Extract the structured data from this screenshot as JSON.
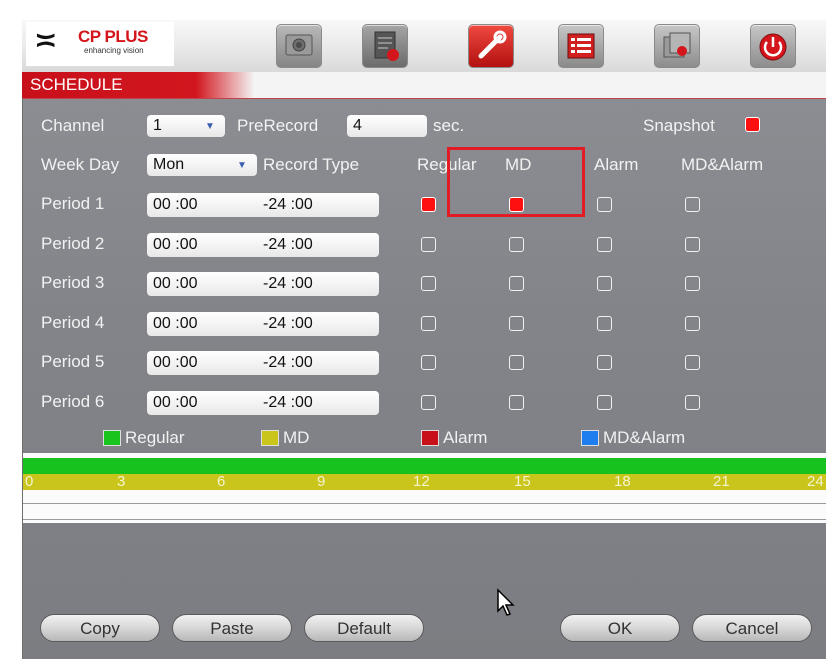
{
  "logo": {
    "brand": "CP PLUS",
    "tagline": "enhancing vision"
  },
  "toolbar": {
    "icons": [
      "camera-icon",
      "document-settings-icon",
      "wrench-icon",
      "list-icon",
      "backup-icon",
      "power-icon"
    ]
  },
  "window": {
    "title": "SCHEDULE"
  },
  "form": {
    "channel_label": "Channel",
    "channel_value": "1",
    "prerecord_label": "PreRecord",
    "prerecord_value": "4",
    "prerecord_unit": "sec.",
    "snapshot_label": "Snapshot",
    "snapshot_checked": true,
    "weekday_label": "Week Day",
    "weekday_value": "Mon",
    "record_type_label": "Record Type",
    "columns": [
      "Regular",
      "MD",
      "Alarm",
      "MD&Alarm"
    ]
  },
  "periods": [
    {
      "label": "Period 1",
      "start": "00 :00",
      "end": "-24 :00",
      "regular": true,
      "md": true,
      "alarm": false,
      "md_alarm": false
    },
    {
      "label": "Period 2",
      "start": "00 :00",
      "end": "-24 :00",
      "regular": false,
      "md": false,
      "alarm": false,
      "md_alarm": false
    },
    {
      "label": "Period 3",
      "start": "00 :00",
      "end": "-24 :00",
      "regular": false,
      "md": false,
      "alarm": false,
      "md_alarm": false
    },
    {
      "label": "Period 4",
      "start": "00 :00",
      "end": "-24 :00",
      "regular": false,
      "md": false,
      "alarm": false,
      "md_alarm": false
    },
    {
      "label": "Period 5",
      "start": "00 :00",
      "end": "-24 :00",
      "regular": false,
      "md": false,
      "alarm": false,
      "md_alarm": false
    },
    {
      "label": "Period 6",
      "start": "00 :00",
      "end": "-24 :00",
      "regular": false,
      "md": false,
      "alarm": false,
      "md_alarm": false
    }
  ],
  "legend": [
    {
      "label": "Regular",
      "color": "#19c41f"
    },
    {
      "label": "MD",
      "color": "#c9c51a"
    },
    {
      "label": "Alarm",
      "color": "#c8101a"
    },
    {
      "label": "MD&Alarm",
      "color": "#1e7ef0"
    }
  ],
  "timeline": {
    "ticks": [
      "0",
      "3",
      "6",
      "9",
      "12",
      "15",
      "18",
      "21",
      "24"
    ],
    "regular_color": "#17c11e",
    "md_color": "#c9c51a"
  },
  "buttons": {
    "copy": "Copy",
    "paste": "Paste",
    "default": "Default",
    "ok": "OK",
    "cancel": "Cancel"
  },
  "colors": {
    "accent": "#d2161f",
    "panel": "#85878c",
    "checked": "#ff1010"
  }
}
